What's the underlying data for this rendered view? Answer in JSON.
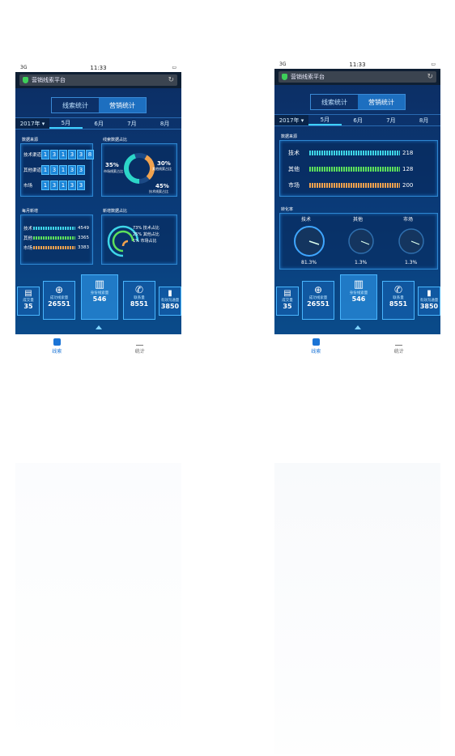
{
  "status": {
    "time": "11:33",
    "signal": "3G"
  },
  "url_title": "营销线索平台",
  "tabs": [
    "线索统计",
    "营销统计"
  ],
  "year": "2017年 ▾",
  "months": [
    "5月",
    "6月",
    "7月",
    "8月"
  ],
  "left": {
    "sources": {
      "title": "数据来源",
      "rows": [
        {
          "label": "技术渠道",
          "digits": [
            "1",
            "3",
            "1",
            "3",
            "3",
            "8"
          ]
        },
        {
          "label": "其他渠道",
          "digits": [
            "1",
            "3",
            "1",
            "3",
            "3"
          ]
        },
        {
          "label": "市场",
          "digits": [
            "1",
            "3",
            "1",
            "3",
            "3"
          ]
        }
      ]
    },
    "ratio": {
      "title": "线索数据占比",
      "pct1": "35%",
      "pct1_label": "市场线索占比",
      "pct2": "30%",
      "pct2_label": "其他线索占比",
      "pct3": "45%",
      "pct3_label": "技术线索占比"
    },
    "monthly": {
      "title": "每月新增",
      "rows": [
        {
          "label": "技术",
          "value": "4549",
          "color": "#3fd6e8"
        },
        {
          "label": "其他",
          "value": "3365",
          "color": "#5de05b"
        },
        {
          "label": "市场",
          "value": "3383",
          "color": "#f0a24e"
        }
      ]
    },
    "newratio": {
      "title": "新增数据占比",
      "items": [
        "73% 技术占比",
        "25% 其他占比",
        "1% 市场占比"
      ]
    }
  },
  "right": {
    "sources": {
      "title": "数据来源",
      "rows": [
        {
          "label": "技术",
          "value": "218",
          "color": "#3fd6e8"
        },
        {
          "label": "其他",
          "value": "128",
          "color": "#5de05b"
        },
        {
          "label": "市场",
          "value": "200",
          "color": "#f0a24e"
        }
      ]
    },
    "conversion": {
      "title": "转化率",
      "gauges": [
        {
          "label": "技术",
          "value": "81.3%"
        },
        {
          "label": "其他",
          "value": "1.3%"
        },
        {
          "label": "市场",
          "value": "1.3%"
        }
      ]
    }
  },
  "dock": [
    {
      "label": "成交量",
      "value": "35"
    },
    {
      "label": "成功线索量",
      "value": "26551"
    },
    {
      "label": "身份线索量",
      "value": "546"
    },
    {
      "label": "联系量",
      "value": "8551"
    },
    {
      "label": "有效沟通量",
      "value": "3850"
    }
  ],
  "nav": [
    "线索",
    "统计"
  ]
}
